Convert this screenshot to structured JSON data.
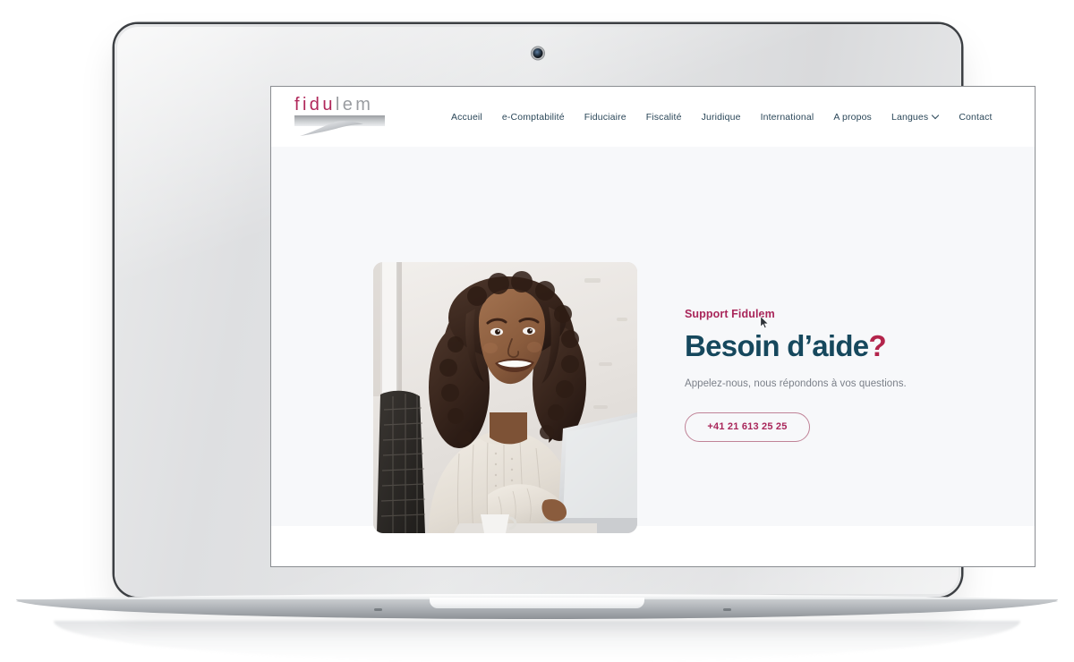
{
  "device": {
    "type": "laptop-mockup",
    "webcam": "webcam-icon"
  },
  "site": {
    "logo": {
      "part_colored": "fidu",
      "part_gray": "lem",
      "color_colored": "#b0275a",
      "color_gray": "#9a9da1"
    },
    "nav": {
      "items": [
        {
          "label": "Accueil",
          "has_dropdown": false
        },
        {
          "label": "e-Comptabilité",
          "has_dropdown": false
        },
        {
          "label": "Fiduciaire",
          "has_dropdown": false
        },
        {
          "label": "Fiscalité",
          "has_dropdown": false
        },
        {
          "label": "Juridique",
          "has_dropdown": false
        },
        {
          "label": "International",
          "has_dropdown": false
        },
        {
          "label": "A propos",
          "has_dropdown": false
        },
        {
          "label": "Langues",
          "has_dropdown": true
        },
        {
          "label": "Contact",
          "has_dropdown": false
        }
      ],
      "text_color": "#2b4759"
    },
    "hero": {
      "eyebrow": "Support Fidulem",
      "title_main": "Besoin d’aide",
      "title_mark": "?",
      "description": "Appelez-nous, nous répondons à vos questions.",
      "phone_button": "+41 21 613 25 25",
      "background": "#f7f8fa",
      "title_color": "#16485d",
      "accent_color": "#a9265a",
      "photo_alt": "Femme souriante devant un ordinateur portable"
    }
  }
}
